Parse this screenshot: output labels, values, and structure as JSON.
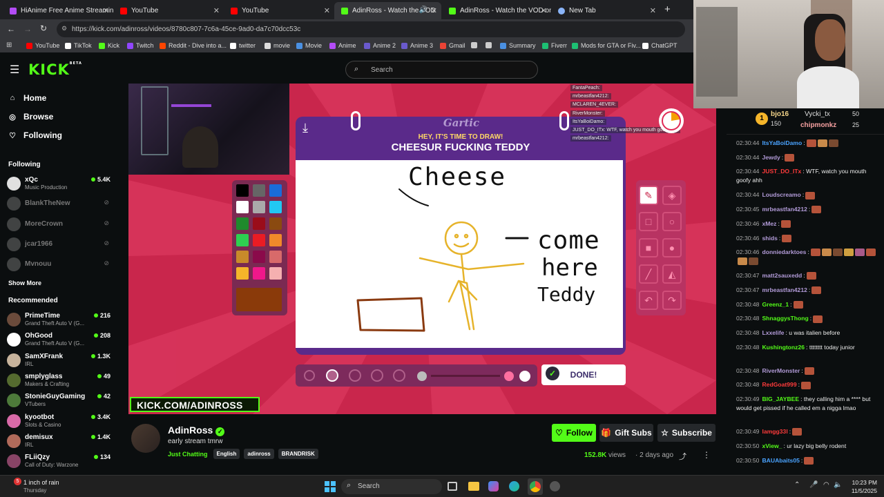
{
  "tabs": [
    {
      "title": "HiAnime Free Anime Streaming",
      "color": "#b34cf7",
      "active": false
    },
    {
      "title": "YouTube",
      "color": "#ff0000",
      "active": false
    },
    {
      "title": "YouTube",
      "color": "#ff0000",
      "active": false
    },
    {
      "title": "AdinRoss - Watch the VOD",
      "color": "#53fc18",
      "active": true
    },
    {
      "title": "AdinRoss - Watch the VOD on",
      "color": "#53fc18",
      "active": false
    },
    {
      "title": "New Tab",
      "color": "#8ab4f8",
      "active": false
    }
  ],
  "address": {
    "url": "https://kick.com/adinross/videos/8780c807-7c6a-45ce-9ad0-da7c70dcc53c"
  },
  "bookmarks": [
    {
      "label": "YouTube",
      "color": "#ff0000"
    },
    {
      "label": "TikTok",
      "color": "#ffffff"
    },
    {
      "label": "Kick",
      "color": "#53fc18"
    },
    {
      "label": "Twitch",
      "color": "#9146ff"
    },
    {
      "label": "Reddit - Dive into a...",
      "color": "#ff4500"
    },
    {
      "label": "twitter",
      "color": "#ffffff"
    },
    {
      "label": "movie",
      "color": "#dddddd"
    },
    {
      "label": "Movie",
      "color": "#4a90e2"
    },
    {
      "label": "Anime",
      "color": "#b34cf7"
    },
    {
      "label": "Anime 2",
      "color": "#6a5acd"
    },
    {
      "label": "Anime 3",
      "color": "#6a5acd"
    },
    {
      "label": "Gmail",
      "color": "#ea4335"
    },
    {
      "label": "",
      "color": "#cccccc"
    },
    {
      "label": "",
      "color": "#cccccc"
    },
    {
      "label": "Summary",
      "color": "#4a90e2"
    },
    {
      "label": "Fiverr",
      "color": "#1dbf73"
    },
    {
      "label": "Mods for GTA or Fiv...",
      "color": "#1dbf73"
    },
    {
      "label": "ChatGPT",
      "color": "#ffffff"
    }
  ],
  "header": {
    "logo": "KICK",
    "beta": "BETA",
    "search_placeholder": "Search"
  },
  "nav": [
    {
      "label": "Home",
      "icon": "home-icon",
      "glyph": "⌂"
    },
    {
      "label": "Browse",
      "icon": "compass-icon",
      "glyph": "◎"
    },
    {
      "label": "Following",
      "icon": "heart-icon",
      "glyph": "♡"
    }
  ],
  "sidebar": {
    "following_title": "Following",
    "show_more": "Show More",
    "recommended_title": "Recommended",
    "following": [
      {
        "name": "xQc",
        "game": "Music Production",
        "viewers": "5.4K",
        "live": true,
        "color": "#e0e0e0"
      },
      {
        "name": "BlankTheNew",
        "live": false,
        "color": "#777"
      },
      {
        "name": "MoreCrown",
        "live": false,
        "color": "#777"
      },
      {
        "name": "jcar1966",
        "live": false,
        "color": "#777"
      },
      {
        "name": "Mvnouu",
        "live": false,
        "color": "#777"
      }
    ],
    "recommended": [
      {
        "name": "PrimeTime",
        "game": "Grand Theft Auto V (G...",
        "viewers": "216",
        "color": "#6b4b3b"
      },
      {
        "name": "OhGood",
        "game": "Grand Theft Auto V (G...",
        "viewers": "208",
        "color": "#ffffff"
      },
      {
        "name": "SamXFrank",
        "game": "IRL",
        "viewers": "1.3K",
        "color": "#c7b39c"
      },
      {
        "name": "smplyglass",
        "game": "Makers & Crafting",
        "viewers": "49",
        "color": "#556b2f"
      },
      {
        "name": "StonieGuyGaming",
        "game": "VTubers",
        "viewers": "42",
        "color": "#4d7a3a"
      },
      {
        "name": "kyootbot",
        "game": "Slots & Casino",
        "viewers": "3.4K",
        "color": "#d86aa8"
      },
      {
        "name": "demisux",
        "game": "IRL",
        "viewers": "1.4K",
        "color": "#b06a5a"
      },
      {
        "name": "FLiiQzy",
        "game": "Call of Duty: Warzone",
        "viewers": "134",
        "color": "#884466"
      }
    ]
  },
  "game": {
    "logo": "Gartic",
    "prompt_small": "HEY, IT'S TIME TO DRAW!",
    "prompt_big": "CHEESUR FUCKING TEDDY",
    "done": "DONE!",
    "drawing_text": [
      "Cheese",
      "come",
      "here",
      "Teddy"
    ],
    "colors": [
      "#000000",
      "#666666",
      "#1a6cd9",
      "#ffffff",
      "#aaaaaa",
      "#22c8f2",
      "#1f8a2c",
      "#9a0d1a",
      "#8a4a10",
      "#2ed050",
      "#ea1c24",
      "#f08a2a",
      "#c88a2a",
      "#8a0a4a",
      "#d86a6a",
      "#f5b52a",
      "#f0188a",
      "#f5b0b0"
    ],
    "current_color": "#8a3a0a",
    "overlay_chat": [
      "FantaPeach:",
      "mrbeastfan4212:",
      "MCLAREN_4EVER:",
      "RiverMonster:",
      "ItsYaBoiDamo:",
      "JUST_DO_ITx: WTF, watch you mouth goofy ahh",
      "mrbeastfan4212:"
    ],
    "stream_overlay": "KICK.COM/ADINROSS"
  },
  "chat_header": {
    "top": [
      {
        "name": "bjo16",
        "value": "150"
      },
      {
        "name": "Vycki_tx",
        "value": "50"
      },
      {
        "name": "chipmonkz",
        "value": "25"
      }
    ],
    "badge_value": "1"
  },
  "chat": [
    {
      "time": "02:30:44",
      "user": "ItsYaBoiDamo",
      "color": "#4aa3ff",
      "text": ":",
      "emotes": 3
    },
    {
      "time": "02:30:44",
      "user": "Jewdy",
      "color": "#b29bd8",
      "text": ":",
      "emotes": 1
    },
    {
      "time": "02:30:44",
      "user": "JUST_DO_ITx",
      "color": "#ff3b3b",
      "text": ": WTF, watch you mouth goofy ahh",
      "emotes": 0
    },
    {
      "time": "02:30:44",
      "user": "Loudscreamo",
      "color": "#b29bd8",
      "text": ":",
      "emotes": 1
    },
    {
      "time": "02:30:45",
      "user": "mrbeastfan4212",
      "color": "#b29bd8",
      "text": ":",
      "emotes": 1
    },
    {
      "time": "02:30:46",
      "user": "xMez",
      "color": "#b29bd8",
      "text": ":",
      "emotes": 1
    },
    {
      "time": "02:30:46",
      "user": "shids",
      "color": "#b29bd8",
      "text": ":",
      "emotes": 1
    },
    {
      "time": "02:30:46",
      "user": "donniedarktoes",
      "color": "#b29bd8",
      "text": ":",
      "emotes": 8
    },
    {
      "time": "02:30:47",
      "user": "matt2sauxedd",
      "color": "#b29bd8",
      "text": ":",
      "emotes": 1
    },
    {
      "time": "02:30:47",
      "user": "mrbeastfan4212",
      "color": "#b29bd8",
      "text": ":",
      "emotes": 1
    },
    {
      "time": "02:30:48",
      "user": "Greenz_1",
      "color": "#53fc18",
      "text": ":",
      "emotes": 1
    },
    {
      "time": "02:30:48",
      "user": "ShnaggysThong",
      "color": "#53fc18",
      "text": ":",
      "emotes": 1
    },
    {
      "time": "02:30:48",
      "user": "Lxxelife",
      "color": "#b29bd8",
      "text": ": u was italien before",
      "emotes": 0
    },
    {
      "time": "02:30:48",
      "user": "Kushingtonz26",
      "color": "#53fc18",
      "text": ": tttttttt today junior",
      "emotes": 0
    },
    {
      "time": "02:30:48",
      "user": "RiverMonster",
      "color": "#b29bd8",
      "text": ":",
      "emotes": 1
    },
    {
      "time": "02:30:48",
      "user": "RedGoat999",
      "color": "#ff3b3b",
      "text": ":",
      "emotes": 1
    },
    {
      "time": "02:30:49",
      "user": "BIG_JAYBEE",
      "color": "#53fc18",
      "text": ": they calling him a **** but would get pissed if he called em a nigga lmao",
      "emotes": 0
    },
    {
      "time": "02:30:49",
      "user": "lamgg33l",
      "color": "#ff3b3b",
      "text": ":",
      "emotes": 1
    },
    {
      "time": "02:30:50",
      "user": "xView_",
      "color": "#53fc18",
      "text": ": ur lazy big belly rodent",
      "emotes": 0
    },
    {
      "time": "02:30:50",
      "user": "BAUAbaits05",
      "color": "#4aa3ff",
      "text": ":",
      "emotes": 1
    }
  ],
  "stream": {
    "streamer": "AdinRoss",
    "title": "early stream tmrw",
    "category": "Just Chatting",
    "tags": [
      "English",
      "adinross",
      "BRANDRISK"
    ],
    "follow": "Follow",
    "gift": "Gift Subs",
    "subscribe": "Subscribe",
    "views": "152.8K",
    "views_label": "views",
    "age": "2 days ago"
  },
  "taskbar": {
    "weather_badge": "5",
    "weather": "1 inch of rain",
    "day": "Thursday",
    "search": "Search",
    "time": "10:23 PM",
    "date": "11/5/2025"
  }
}
